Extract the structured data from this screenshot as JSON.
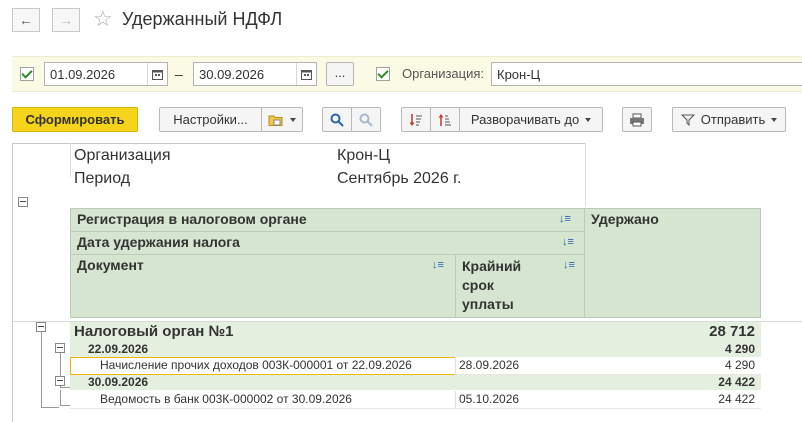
{
  "window": {
    "title": "Удержанный НДФЛ"
  },
  "nav": {
    "back": "←",
    "forward": "→",
    "star": "☆"
  },
  "filters": {
    "date_from": "01.09.2026",
    "date_sep": "–",
    "date_to": "30.09.2026",
    "period_btn": "...",
    "org_label": "Организация:",
    "org_value": "Крон-Ц"
  },
  "toolbar": {
    "generate": "Сформировать",
    "settings": "Настройки...",
    "expand_to": "Разворачивать до",
    "send": "Отправить"
  },
  "report": {
    "header_rows": [
      {
        "label": "Организация",
        "value": "Крон-Ц"
      },
      {
        "label": "Период",
        "value": "Сентябрь 2026 г."
      }
    ],
    "columns": {
      "registration": "Регистрация в налоговом органе",
      "withholding_date": "Дата удержания налога",
      "document": "Документ",
      "deadline_l1": "Крайний",
      "deadline_l2": "срок",
      "deadline_l3": "уплаты",
      "withheld": "Удержано"
    },
    "group": {
      "name": "Налоговый орган №1",
      "total": "28 712"
    },
    "subgroups": [
      {
        "date": "22.09.2026",
        "total": "4 290",
        "doc": "Начисление прочих доходов 003К-000001 от 22.09.2026",
        "deadline": "28.09.2026",
        "amount": "4 290"
      },
      {
        "date": "30.09.2026",
        "total": "24 422",
        "doc": "Ведомость в банк 003К-000002 от 30.09.2026",
        "deadline": "05.10.2026",
        "amount": "24 422"
      }
    ]
  },
  "colors": {
    "accent": "#f7d41c",
    "header_bg": "#d6e5cf",
    "filter_bg": "#fbfbe5",
    "selection": "#f2b600"
  }
}
